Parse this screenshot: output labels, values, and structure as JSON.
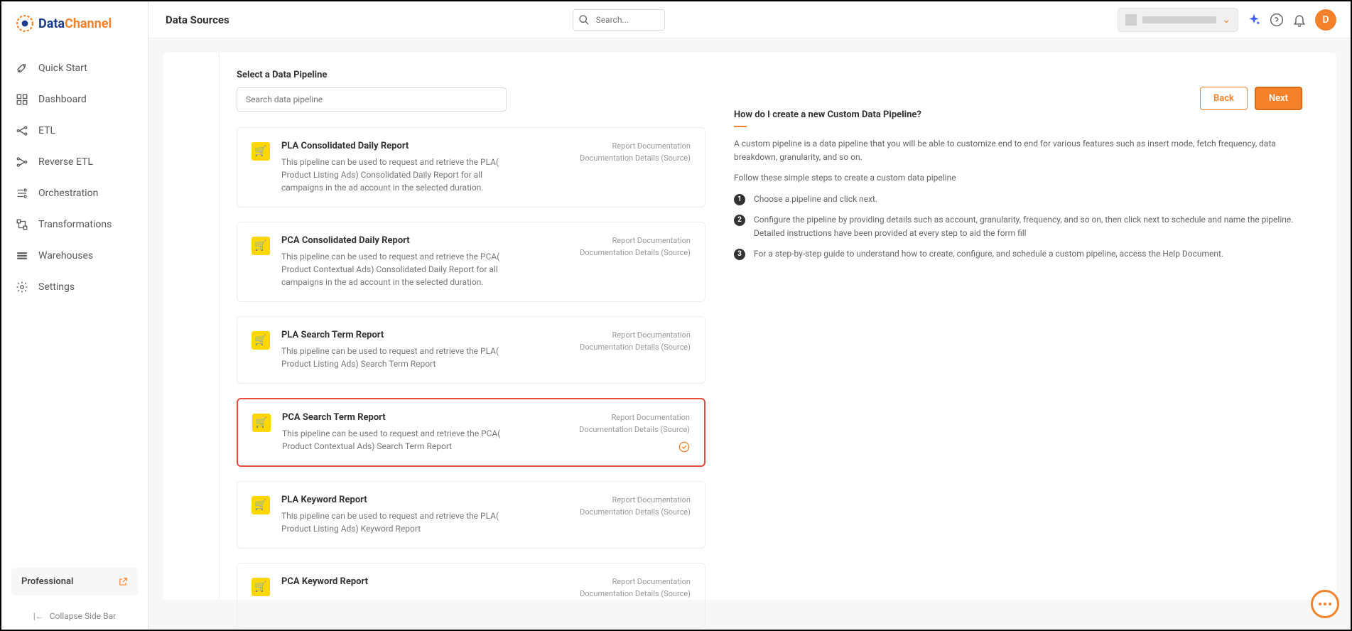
{
  "brand": {
    "data": "Data",
    "channel": "Channel"
  },
  "sidebar": {
    "items": [
      {
        "label": "Quick Start"
      },
      {
        "label": "Dashboard"
      },
      {
        "label": "ETL"
      },
      {
        "label": "Reverse ETL"
      },
      {
        "label": "Orchestration"
      },
      {
        "label": "Transformations"
      },
      {
        "label": "Warehouses"
      },
      {
        "label": "Settings"
      }
    ],
    "plan": "Professional",
    "collapse": "Collapse Side Bar"
  },
  "topbar": {
    "title": "Data Sources",
    "search_placeholder": "Search...",
    "avatar": "D"
  },
  "panel": {
    "section_title": "Select a Data Pipeline",
    "search_placeholder": "Search data pipeline",
    "back": "Back",
    "next": "Next"
  },
  "pipelines": [
    {
      "title": "PLA Consolidated Daily Report",
      "desc": "This pipeline can be used to request and retrieve the PLA( Product Listing Ads) Consolidated Daily Report for all campaigns in the ad account in the selected duration.",
      "link1": "Report Documentation",
      "link2": "Documentation Details (Source)"
    },
    {
      "title": "PCA Consolidated Daily Report",
      "desc": "This pipeline can be used to request and retrieve the PCA( Product Contextual Ads) Consolidated Daily Report for all campaigns in the ad account in the selected duration.",
      "link1": "Report Documentation",
      "link2": "Documentation Details (Source)"
    },
    {
      "title": "PLA Search Term Report",
      "desc": "This pipeline can be used to request and retrieve the PLA( Product Listing Ads) Search Term Report",
      "link1": "Report Documentation",
      "link2": "Documentation Details (Source)"
    },
    {
      "title": "PCA Search Term Report",
      "desc": "This pipeline can be used to request and retrieve the PCA( Product Contextual Ads) Search Term Report",
      "link1": "Report Documentation",
      "link2": "Documentation Details (Source)"
    },
    {
      "title": "PLA Keyword Report",
      "desc": "This pipeline can be used to request and retrieve the PLA( Product Listing Ads) Keyword Report",
      "link1": "Report Documentation",
      "link2": "Documentation Details (Source)"
    },
    {
      "title": "PCA Keyword Report",
      "desc": "",
      "link1": "Report Documentation",
      "link2": "Documentation Details (Source)"
    }
  ],
  "help": {
    "title": "How do I create a new Custom Data Pipeline?",
    "intro": "A custom pipeline is a data pipeline that you will be able to customize end to end for various features such as insert mode, fetch frequency, data breakdown, granularity, and so on.",
    "follow": "Follow these simple steps to create a custom data pipeline",
    "steps": [
      "Choose a pipeline and click next.",
      "Configure the pipeline by providing details such as account, granularity, frequency, and so on, then click next to schedule and name the pipeline. Detailed instructions have been provided at every step to aid the form fill",
      "For a step-by-step guide to understand how to create, configure, and schedule a custom pipeline, access the Help Document."
    ]
  }
}
